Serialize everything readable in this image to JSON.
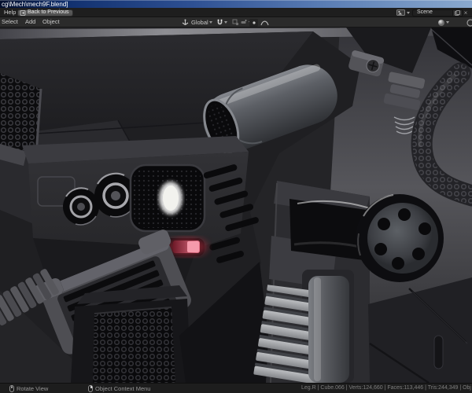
{
  "window": {
    "title": "cg\\Mech\\mech9F.blend]"
  },
  "topbar": {
    "help_menu": "Help",
    "back_button": "Back to Previous",
    "scene_field": "Scene"
  },
  "viewport_header": {
    "menus": [
      "Select",
      "Add",
      "Object"
    ],
    "orientation": "Global"
  },
  "statusbar": {
    "hint_rotate": "Rotate View",
    "hint_context": "Object Context Menu",
    "stats": "Leg.R | Cube.066 | Verts:124,660 | Faces:113,446 | Tris:244,349 | Obj"
  },
  "icons": {
    "back": "back-arrow-icon",
    "workspace": "workspace-icon",
    "new_scene": "new-scene-icon",
    "unlink": "unlink-x-icon",
    "orientation": "transform-orientation-icon",
    "snap": "magnet-icon",
    "snap_target": "snap-target-icon",
    "proportional": "proportional-editing-icon",
    "falloff": "falloff-curve-icon",
    "shading": "viewport-shading-icon",
    "mouse_middle": "mouse-middle-button-icon",
    "mouse_right": "mouse-right-button-icon"
  },
  "colors": {
    "titlebar_dark": "#04102e",
    "titlebar_light": "#8aa9ce",
    "ui_dark": "#1d1d1d",
    "header_bg": "#2b2b2b",
    "viewport_bg": "#242427",
    "glow_red": "#e8748a",
    "glow_white": "#f4f4f0"
  }
}
